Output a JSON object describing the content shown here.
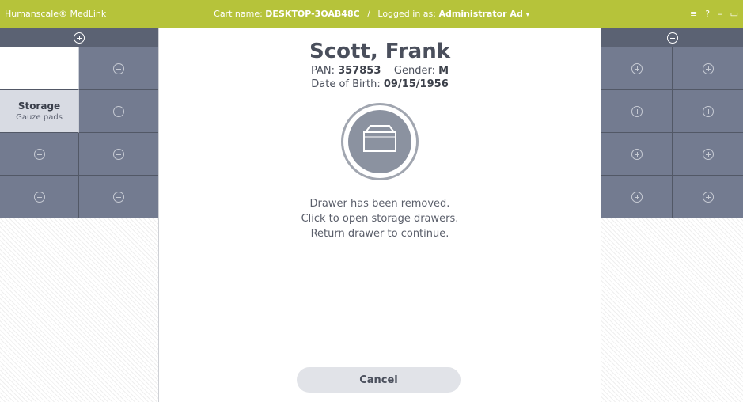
{
  "titlebar": {
    "app_name": "Humanscale® MedLink",
    "cart_label": "Cart name:",
    "cart_value": "DESKTOP-3OAB48C",
    "sep": "/",
    "logged_label": "Logged in as:",
    "user_value": "Administrator Ad",
    "controls": [
      "≡",
      "?",
      "–",
      "▭"
    ]
  },
  "left_panel": {
    "storage": {
      "label": "Storage",
      "sub": "Gauze pads"
    }
  },
  "patient": {
    "name": "Scott, Frank",
    "pan_label": "PAN:",
    "pan_value": "357853",
    "gender_label": "Gender:",
    "gender_value": "M",
    "dob_label": "Date of Birth:",
    "dob_value": "09/15/1956"
  },
  "message": {
    "line1": "Drawer has been removed.",
    "line2": "Click to open storage drawers.",
    "line3": "Return drawer to continue."
  },
  "buttons": {
    "cancel": "Cancel"
  },
  "icons": {
    "add": "plus-circle-icon",
    "drawer": "drawer-icon",
    "menu": "menu-icon",
    "help": "help-icon",
    "minimize": "minimize-icon",
    "maximize": "maximize-icon"
  },
  "colors": {
    "titlebar": "#b6c33a",
    "cell": "#737b90",
    "panel_header": "#5b6273"
  }
}
